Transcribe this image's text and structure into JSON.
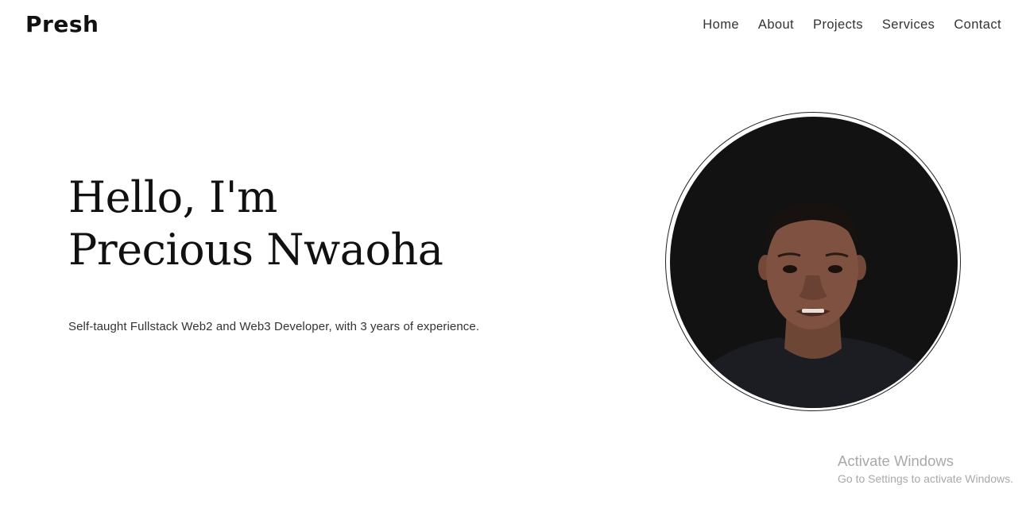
{
  "header": {
    "logo": "Presh",
    "nav": [
      {
        "label": "Home"
      },
      {
        "label": "About"
      },
      {
        "label": "Projects"
      },
      {
        "label": "Services"
      },
      {
        "label": "Contact"
      }
    ]
  },
  "hero": {
    "title_line1": "Hello, I'm",
    "title_line2": "Precious Nwaoha",
    "subtitle": "Self-taught Fullstack Web2 and Web3 Developer, with 3 years of experience.",
    "photo_icon": "profile-photo"
  },
  "os_watermark": {
    "title": "Activate Windows",
    "subtitle": "Go to Settings to activate Windows."
  },
  "colors": {
    "background": "#ffffff",
    "text": "#111111",
    "nav_text": "#333333",
    "photo_background": "#121212",
    "watermark": "#a9a9a9"
  }
}
